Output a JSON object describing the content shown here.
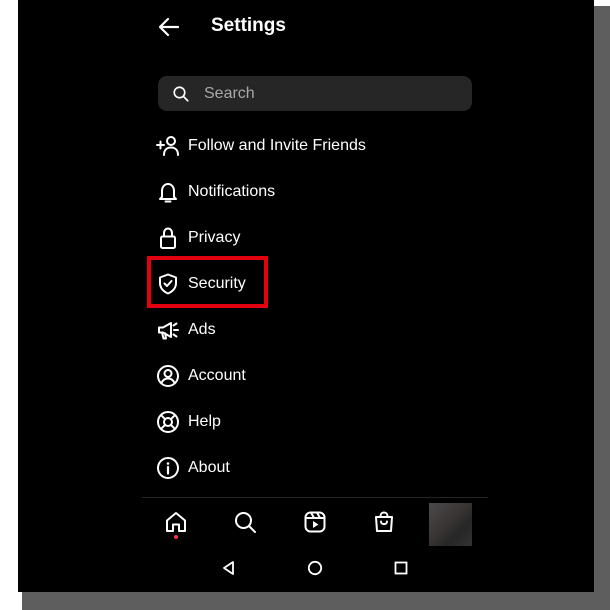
{
  "header": {
    "title": "Settings",
    "back_icon": "arrow-left-icon"
  },
  "search": {
    "placeholder": "Search",
    "value": ""
  },
  "menu": {
    "items": [
      {
        "label": "Follow and Invite Friends",
        "icon": "add-person-icon"
      },
      {
        "label": "Notifications",
        "icon": "bell-icon"
      },
      {
        "label": "Privacy",
        "icon": "lock-icon"
      },
      {
        "label": "Security",
        "icon": "shield-check-icon"
      },
      {
        "label": "Ads",
        "icon": "megaphone-icon"
      },
      {
        "label": "Account",
        "icon": "person-circle-icon"
      },
      {
        "label": "Help",
        "icon": "lifebuoy-icon"
      },
      {
        "label": "About",
        "icon": "info-icon"
      }
    ],
    "highlighted": "Security"
  },
  "bottom_nav": [
    "home-icon",
    "search-icon",
    "reels-icon",
    "shop-bag-icon",
    "profile-avatar"
  ],
  "system_nav": [
    "back-triangle-icon",
    "home-circle-icon",
    "recents-square-icon"
  ],
  "colors": {
    "background": "#000000",
    "text": "#ffffff",
    "search_bg": "#262626",
    "placeholder": "#a8a8a8",
    "highlight": "#e3000f",
    "notification_dot": "#ff3040"
  }
}
